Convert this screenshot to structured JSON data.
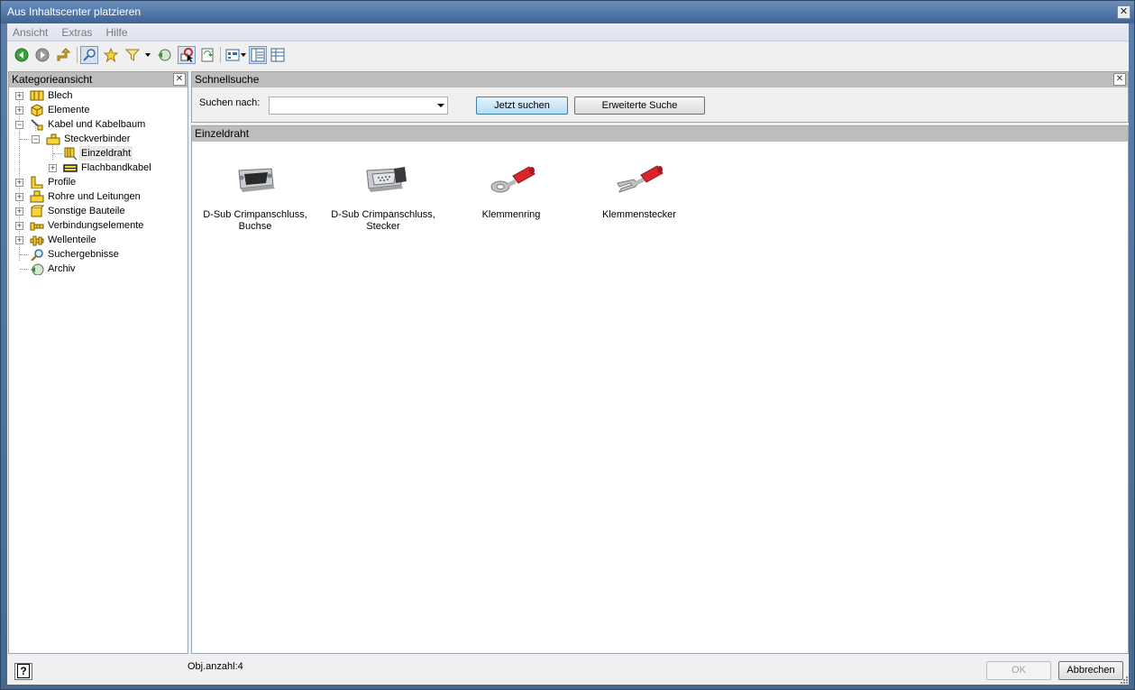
{
  "window": {
    "title": "Aus Inhaltscenter platzieren",
    "close_glyph": "✕"
  },
  "menu": [
    "Ansicht",
    "Extras",
    "Hilfe"
  ],
  "toolbar": {
    "buttons": [
      "back-icon",
      "forward-icon",
      "up-icon",
      "search-view-icon",
      "favorites-icon",
      "filter-icon",
      "archive-icon",
      "place-icon",
      "refresh-icon",
      "view-options-icon",
      "tree-view-icon",
      "table-view-icon"
    ]
  },
  "left_panel": {
    "title": "Kategorieansicht",
    "tree": [
      {
        "label": "Blech",
        "expander": "+"
      },
      {
        "label": "Elemente",
        "expander": "+"
      },
      {
        "label": "Kabel und Kabelbaum",
        "expander": "−"
      },
      {
        "label": "Steckverbinder",
        "expander": "−"
      },
      {
        "label": "Einzeldraht",
        "expander": ""
      },
      {
        "label": "Flachbandkabel",
        "expander": "+"
      },
      {
        "label": "Profile",
        "expander": "+"
      },
      {
        "label": "Rohre und Leitungen",
        "expander": "+"
      },
      {
        "label": "Sonstige Bauteile",
        "expander": "+"
      },
      {
        "label": "Verbindungselemente",
        "expander": "+"
      },
      {
        "label": "Wellenteile",
        "expander": "+"
      },
      {
        "label": "Suchergebnisse",
        "expander": ""
      },
      {
        "label": "Archiv",
        "expander": ""
      }
    ]
  },
  "quick_search": {
    "title": "Schnellsuche",
    "label": "Suchen nach:",
    "value": "",
    "search_button": "Jetzt suchen",
    "advanced_button": "Erweiterte Suche"
  },
  "content": {
    "title": "Einzeldraht",
    "items": [
      {
        "label": "D-Sub Crimpanschluss,\nBuchse"
      },
      {
        "label": "D-Sub Crimpanschluss,\nStecker"
      },
      {
        "label": "Klemmenring"
      },
      {
        "label": "Klemmenstecker"
      }
    ]
  },
  "status": {
    "count": "Obj.anzahl:4",
    "help": "?",
    "ok": "OK",
    "cancel": "Abbrechen"
  },
  "colors": {
    "accent": "#3c7fb1",
    "header": "#bdbdbd",
    "terminal_red": "#d8262a"
  }
}
